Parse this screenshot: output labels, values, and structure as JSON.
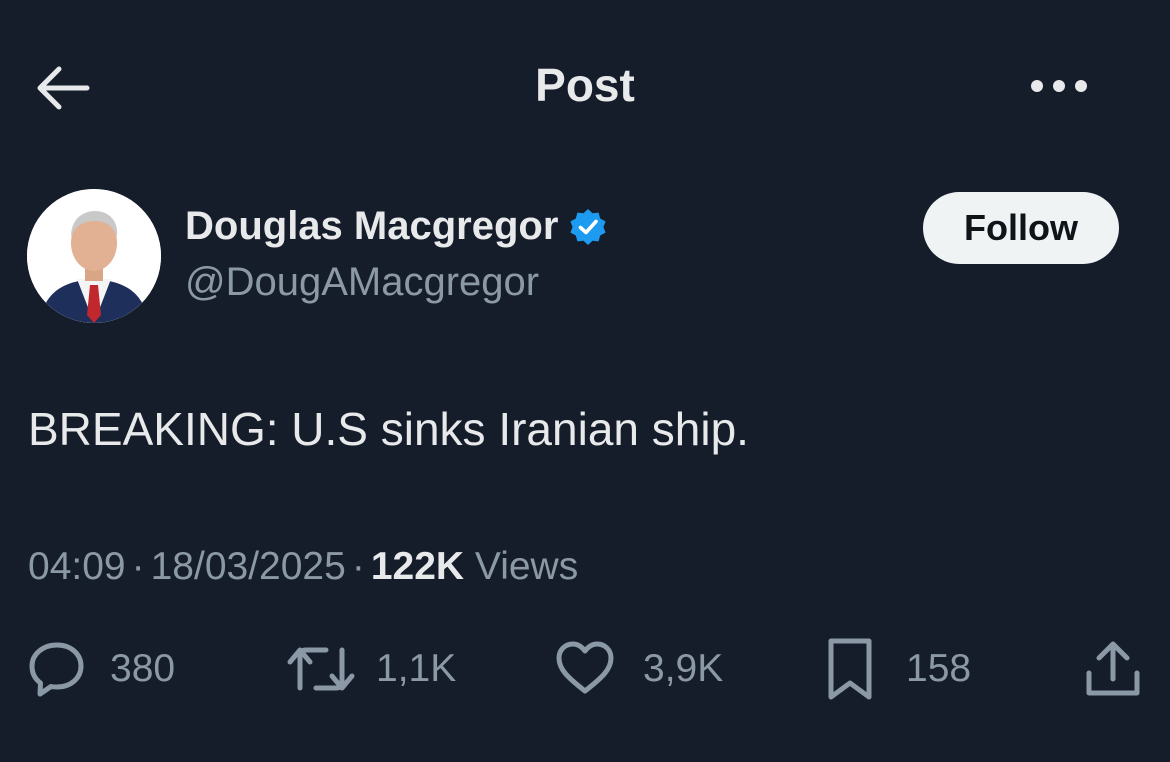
{
  "header": {
    "title": "Post",
    "back_icon": "arrow-left-icon",
    "more_icon": "more-horizontal-icon"
  },
  "author": {
    "display_name": "Douglas Macgregor",
    "handle": "@DougAMacgregor",
    "verified": true,
    "verified_color": "#1d9bf0",
    "follow_label": "Follow"
  },
  "post": {
    "text": "BREAKING: U.S sinks Iranian ship."
  },
  "meta": {
    "time": "04:09",
    "date": "18/03/2025",
    "views_count": "122K",
    "views_label": "Views",
    "separator": "·"
  },
  "actions": {
    "replies": "380",
    "reposts": "1,1K",
    "likes": "3,9K",
    "bookmarks": "158"
  },
  "colors": {
    "background": "#161d2a",
    "primary_text": "#e7e9ea",
    "secondary_text": "#8b98a5",
    "follow_button_bg": "#eff3f4",
    "follow_button_text": "#0f1419"
  }
}
